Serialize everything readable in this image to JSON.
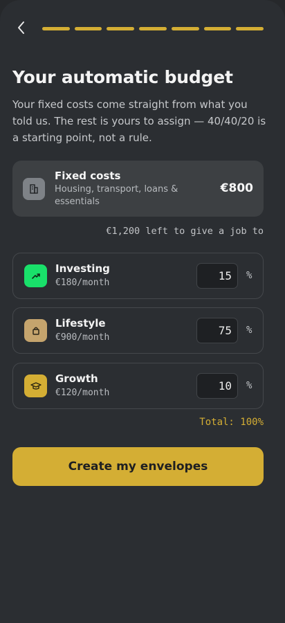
{
  "nav": {
    "back_icon": "chevron-left-icon"
  },
  "progress": {
    "steps_total": 7,
    "steps_completed": 7,
    "color": "#d4ae34"
  },
  "header": {
    "title": "Your automatic budget",
    "subtitle": "Your fixed costs come straight from what you told us. The rest is yours to assign — 40/40/20 is a starting point, not a rule."
  },
  "fixed": {
    "icon": "building-icon",
    "title": "Fixed costs",
    "description": "Housing, transport, loans & essentials",
    "amount": "€800"
  },
  "remaining_text": "€1,200 left to give a job to",
  "envelopes": [
    {
      "name": "Investing",
      "amount": "€180/month",
      "percent": "15",
      "unit": "%",
      "icon": "trending-up-icon",
      "color": "#19e06a"
    },
    {
      "name": "Lifestyle",
      "amount": "€900/month",
      "percent": "75",
      "unit": "%",
      "icon": "shopping-bag-icon",
      "color": "#c5a46d"
    },
    {
      "name": "Growth",
      "amount": "€120/month",
      "percent": "10",
      "unit": "%",
      "icon": "graduation-cap-icon",
      "color": "#d4ae34"
    }
  ],
  "total_text": "Total: 100%",
  "cta_label": "Create my envelopes"
}
